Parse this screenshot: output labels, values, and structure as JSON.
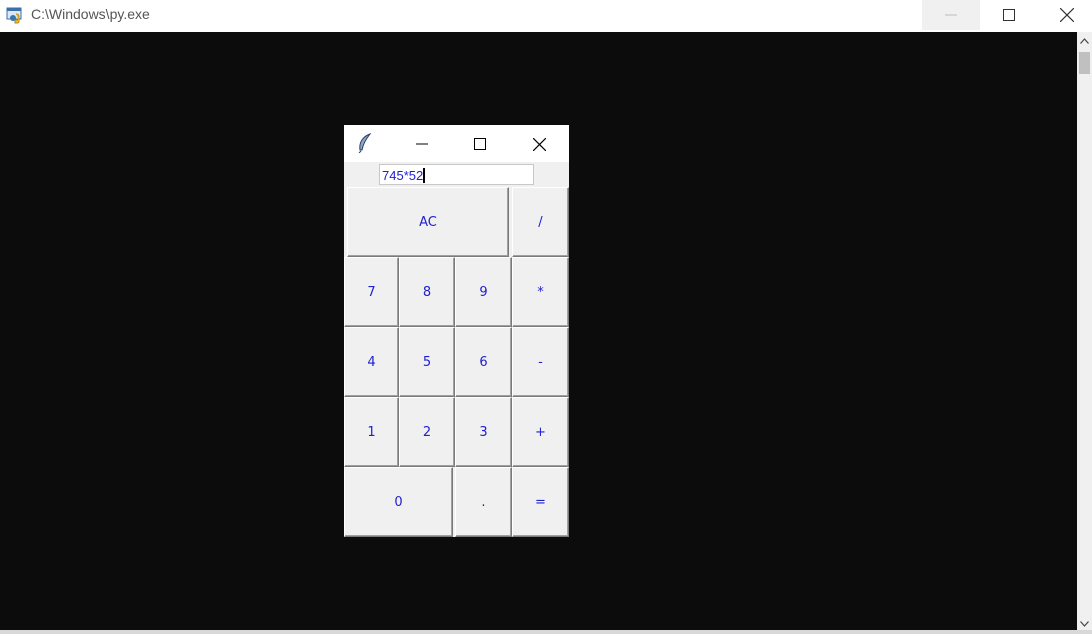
{
  "console": {
    "title": "C:\\Windows\\py.exe"
  },
  "calculator": {
    "entry_value": "745*52",
    "buttons": {
      "ac": "AC",
      "div": "/",
      "n7": "7",
      "n8": "8",
      "n9": "9",
      "mul": "*",
      "n4": "4",
      "n5": "5",
      "n6": "6",
      "sub": "-",
      "n1": "1",
      "n2": "2",
      "n3": "3",
      "add": "+",
      "n0": "0",
      "dot": ".",
      "eq": "="
    }
  },
  "colors": {
    "console_bg": "#0c0c0c",
    "button_text": "#2020d0",
    "button_face": "#f0f0f0"
  }
}
